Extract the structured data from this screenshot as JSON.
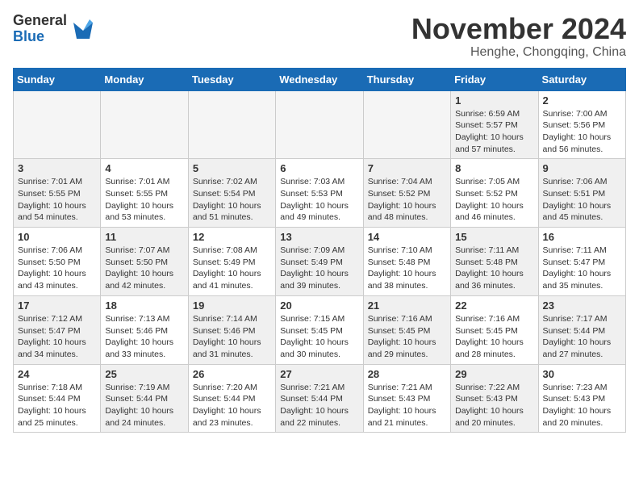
{
  "header": {
    "logo_general": "General",
    "logo_blue": "Blue",
    "month_title": "November 2024",
    "location": "Henghe, Chongqing, China"
  },
  "weekdays": [
    "Sunday",
    "Monday",
    "Tuesday",
    "Wednesday",
    "Thursday",
    "Friday",
    "Saturday"
  ],
  "weeks": [
    [
      {
        "day": "",
        "info": "",
        "empty": true
      },
      {
        "day": "",
        "info": "",
        "empty": true
      },
      {
        "day": "",
        "info": "",
        "empty": true
      },
      {
        "day": "",
        "info": "",
        "empty": true
      },
      {
        "day": "",
        "info": "",
        "empty": true
      },
      {
        "day": "1",
        "info": "Sunrise: 6:59 AM\nSunset: 5:57 PM\nDaylight: 10 hours\nand 57 minutes.",
        "shaded": true
      },
      {
        "day": "2",
        "info": "Sunrise: 7:00 AM\nSunset: 5:56 PM\nDaylight: 10 hours\nand 56 minutes.",
        "shaded": false
      }
    ],
    [
      {
        "day": "3",
        "info": "Sunrise: 7:01 AM\nSunset: 5:55 PM\nDaylight: 10 hours\nand 54 minutes.",
        "shaded": true
      },
      {
        "day": "4",
        "info": "Sunrise: 7:01 AM\nSunset: 5:55 PM\nDaylight: 10 hours\nand 53 minutes.",
        "shaded": false
      },
      {
        "day": "5",
        "info": "Sunrise: 7:02 AM\nSunset: 5:54 PM\nDaylight: 10 hours\nand 51 minutes.",
        "shaded": true
      },
      {
        "day": "6",
        "info": "Sunrise: 7:03 AM\nSunset: 5:53 PM\nDaylight: 10 hours\nand 49 minutes.",
        "shaded": false
      },
      {
        "day": "7",
        "info": "Sunrise: 7:04 AM\nSunset: 5:52 PM\nDaylight: 10 hours\nand 48 minutes.",
        "shaded": true
      },
      {
        "day": "8",
        "info": "Sunrise: 7:05 AM\nSunset: 5:52 PM\nDaylight: 10 hours\nand 46 minutes.",
        "shaded": false
      },
      {
        "day": "9",
        "info": "Sunrise: 7:06 AM\nSunset: 5:51 PM\nDaylight: 10 hours\nand 45 minutes.",
        "shaded": true
      }
    ],
    [
      {
        "day": "10",
        "info": "Sunrise: 7:06 AM\nSunset: 5:50 PM\nDaylight: 10 hours\nand 43 minutes.",
        "shaded": false
      },
      {
        "day": "11",
        "info": "Sunrise: 7:07 AM\nSunset: 5:50 PM\nDaylight: 10 hours\nand 42 minutes.",
        "shaded": true
      },
      {
        "day": "12",
        "info": "Sunrise: 7:08 AM\nSunset: 5:49 PM\nDaylight: 10 hours\nand 41 minutes.",
        "shaded": false
      },
      {
        "day": "13",
        "info": "Sunrise: 7:09 AM\nSunset: 5:49 PM\nDaylight: 10 hours\nand 39 minutes.",
        "shaded": true
      },
      {
        "day": "14",
        "info": "Sunrise: 7:10 AM\nSunset: 5:48 PM\nDaylight: 10 hours\nand 38 minutes.",
        "shaded": false
      },
      {
        "day": "15",
        "info": "Sunrise: 7:11 AM\nSunset: 5:48 PM\nDaylight: 10 hours\nand 36 minutes.",
        "shaded": true
      },
      {
        "day": "16",
        "info": "Sunrise: 7:11 AM\nSunset: 5:47 PM\nDaylight: 10 hours\nand 35 minutes.",
        "shaded": false
      }
    ],
    [
      {
        "day": "17",
        "info": "Sunrise: 7:12 AM\nSunset: 5:47 PM\nDaylight: 10 hours\nand 34 minutes.",
        "shaded": true
      },
      {
        "day": "18",
        "info": "Sunrise: 7:13 AM\nSunset: 5:46 PM\nDaylight: 10 hours\nand 33 minutes.",
        "shaded": false
      },
      {
        "day": "19",
        "info": "Sunrise: 7:14 AM\nSunset: 5:46 PM\nDaylight: 10 hours\nand 31 minutes.",
        "shaded": true
      },
      {
        "day": "20",
        "info": "Sunrise: 7:15 AM\nSunset: 5:45 PM\nDaylight: 10 hours\nand 30 minutes.",
        "shaded": false
      },
      {
        "day": "21",
        "info": "Sunrise: 7:16 AM\nSunset: 5:45 PM\nDaylight: 10 hours\nand 29 minutes.",
        "shaded": true
      },
      {
        "day": "22",
        "info": "Sunrise: 7:16 AM\nSunset: 5:45 PM\nDaylight: 10 hours\nand 28 minutes.",
        "shaded": false
      },
      {
        "day": "23",
        "info": "Sunrise: 7:17 AM\nSunset: 5:44 PM\nDaylight: 10 hours\nand 27 minutes.",
        "shaded": true
      }
    ],
    [
      {
        "day": "24",
        "info": "Sunrise: 7:18 AM\nSunset: 5:44 PM\nDaylight: 10 hours\nand 25 minutes.",
        "shaded": false
      },
      {
        "day": "25",
        "info": "Sunrise: 7:19 AM\nSunset: 5:44 PM\nDaylight: 10 hours\nand 24 minutes.",
        "shaded": true
      },
      {
        "day": "26",
        "info": "Sunrise: 7:20 AM\nSunset: 5:44 PM\nDaylight: 10 hours\nand 23 minutes.",
        "shaded": false
      },
      {
        "day": "27",
        "info": "Sunrise: 7:21 AM\nSunset: 5:44 PM\nDaylight: 10 hours\nand 22 minutes.",
        "shaded": true
      },
      {
        "day": "28",
        "info": "Sunrise: 7:21 AM\nSunset: 5:43 PM\nDaylight: 10 hours\nand 21 minutes.",
        "shaded": false
      },
      {
        "day": "29",
        "info": "Sunrise: 7:22 AM\nSunset: 5:43 PM\nDaylight: 10 hours\nand 20 minutes.",
        "shaded": true
      },
      {
        "day": "30",
        "info": "Sunrise: 7:23 AM\nSunset: 5:43 PM\nDaylight: 10 hours\nand 20 minutes.",
        "shaded": false
      }
    ]
  ]
}
